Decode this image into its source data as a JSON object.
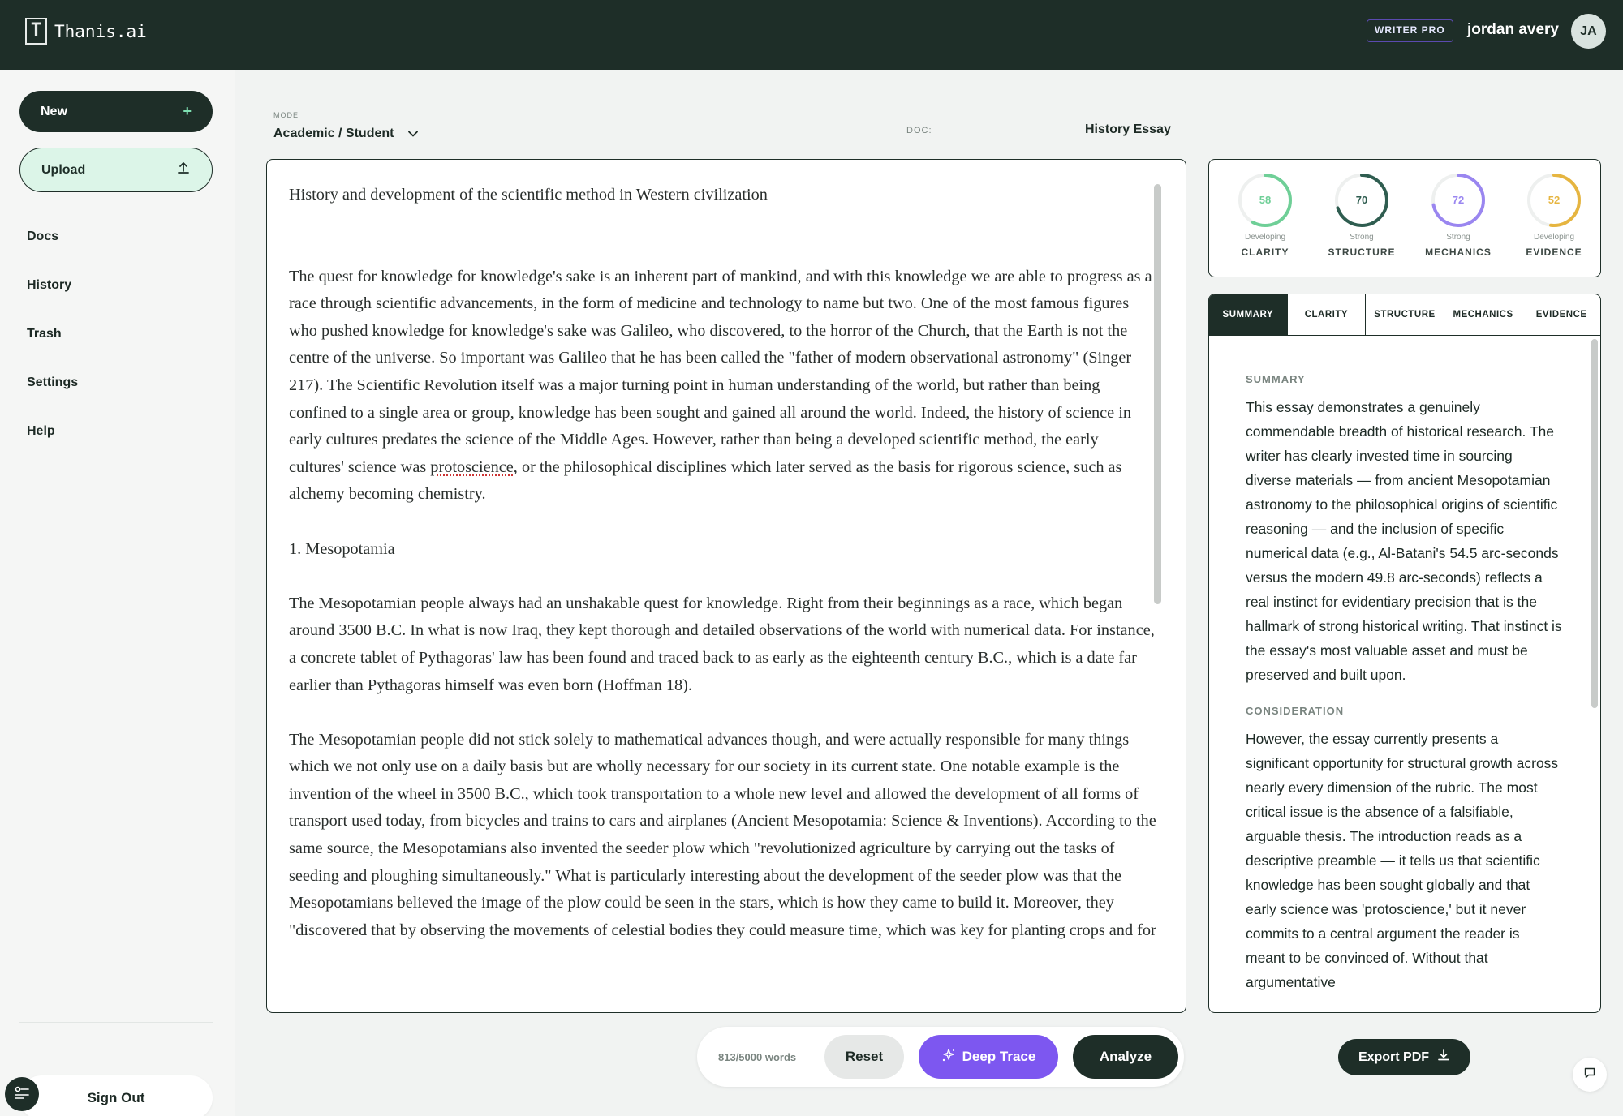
{
  "app": {
    "name": "Thanis.ai"
  },
  "header": {
    "plan_badge": "WRITER PRO",
    "username": "jordan avery",
    "avatar_initials": "JA"
  },
  "sidebar": {
    "new_label": "New",
    "upload_label": "Upload",
    "items": [
      {
        "label": "Docs"
      },
      {
        "label": "History"
      },
      {
        "label": "Trash"
      },
      {
        "label": "Settings"
      },
      {
        "label": "Help"
      }
    ],
    "sign_out_label": "Sign Out"
  },
  "toolbar": {
    "mode_label": "MODE",
    "mode_value": "Academic / Student",
    "doc_label": "DOC:",
    "doc_title": "History Essay"
  },
  "editor": {
    "title": "History and development of the scientific method in Western civilization",
    "p1_before": "The quest for knowledge for knowledge's sake is an inherent part of mankind, and with this knowledge we are able to progress as a race through scientific advancements, in the form of medicine and technology to name but two. One of the most famous figures who pushed knowledge for knowledge's sake was Galileo, who discovered, to the horror of the Church, that the Earth is not the centre of the universe. So important was Galileo that he has been called the \"father of modern observational astronomy\" (Singer 217). The Scientific Revolution itself was a major turning point in human understanding of the world, but rather than being confined to a single area or group, knowledge has been sought and gained all around the world. Indeed, the history of science in early cultures predates the science of the Middle Ages. However, rather than being a developed scientific method, the early cultures' science was ",
    "p1_flag": "protoscience",
    "p1_after": ", or the philosophical disciplines which later served as the basis for rigorous science, such as alchemy becoming chemistry.",
    "section_heading": "1. Mesopotamia",
    "p2": "The Mesopotamian people always had an unshakable quest for knowledge. Right from their beginnings as a race, which began around 3500 B.C. In what is now Iraq, they kept thorough and detailed observations of the world with numerical data. For instance, a concrete tablet of Pythagoras' law has been found and traced back to as early as the eighteenth century B.C., which is a date far earlier than Pythagoras himself was even born (Hoffman 18).",
    "p3": "The Mesopotamian people did not stick solely to mathematical advances though, and were actually responsible for many things which we not only use on a daily basis but are wholly necessary for our society in its current state. One notable example is the invention of the wheel in 3500 B.C., which took transportation to a whole new level and allowed the development of all forms of transport used today, from bicycles and trains to cars and airplanes (Ancient Mesopotamia: Science & Inventions). According to the same source, the Mesopotamians also invented the seeder plow which \"revolutionized agriculture by carrying out the tasks of seeding and ploughing simultaneously.\" What is particularly interesting about the development of the seeder plow was that the Mesopotamians believed the image of the plow could be seen in the stars, which is how they came to build it. Moreover, they \"discovered that by observing the movements of celestial bodies they could measure time, which was key for planting crops and for"
  },
  "actions": {
    "word_count": "813/5000 words",
    "reset_label": "Reset",
    "deep_trace_label": "Deep Trace",
    "analyze_label": "Analyze",
    "export_label": "Export PDF"
  },
  "scores": [
    {
      "name": "CLARITY",
      "value": "58",
      "level": "Developing",
      "fraction": 0.58,
      "color": "#6fcf97"
    },
    {
      "name": "STRUCTURE",
      "value": "70",
      "level": "Strong",
      "fraction": 0.7,
      "color": "#2f5d50"
    },
    {
      "name": "MECHANICS",
      "value": "72",
      "level": "Strong",
      "fraction": 0.72,
      "color": "#9a86f0"
    },
    {
      "name": "EVIDENCE",
      "value": "52",
      "level": "Developing",
      "fraction": 0.52,
      "color": "#e6b540"
    }
  ],
  "feedback": {
    "tabs": [
      "SUMMARY",
      "CLARITY",
      "STRUCTURE",
      "MECHANICS",
      "EVIDENCE"
    ],
    "active_tab": "SUMMARY",
    "summary_heading": "SUMMARY",
    "summary_text": "This essay demonstrates a genuinely commendable breadth of historical research. The writer has clearly invested time in sourcing diverse materials — from ancient Mesopotamian astronomy to the philosophical origins of scientific reasoning — and the inclusion of specific numerical data (e.g., Al-Batani's 54.5 arc-seconds versus the modern 49.8 arc-seconds) reflects a real instinct for evidentiary precision that is the hallmark of strong historical writing. That instinct is the essay's most valuable asset and must be preserved and built upon.",
    "consideration_heading": "CONSIDERATION",
    "consideration_text": "However, the essay currently presents a significant opportunity for structural growth across nearly every dimension of the rubric. The most critical issue is the absence of a falsifiable, arguable thesis. The introduction reads as a descriptive preamble — it tells us that scientific knowledge has been sought globally and that early science was 'protoscience,' but it never commits to a central argument the reader is meant to be convinced of. Without that argumentative"
  },
  "colors": {
    "brand_dark": "#1e2e28",
    "accent_purple": "#7d57f0",
    "upload_bg": "#dcf5e8"
  }
}
